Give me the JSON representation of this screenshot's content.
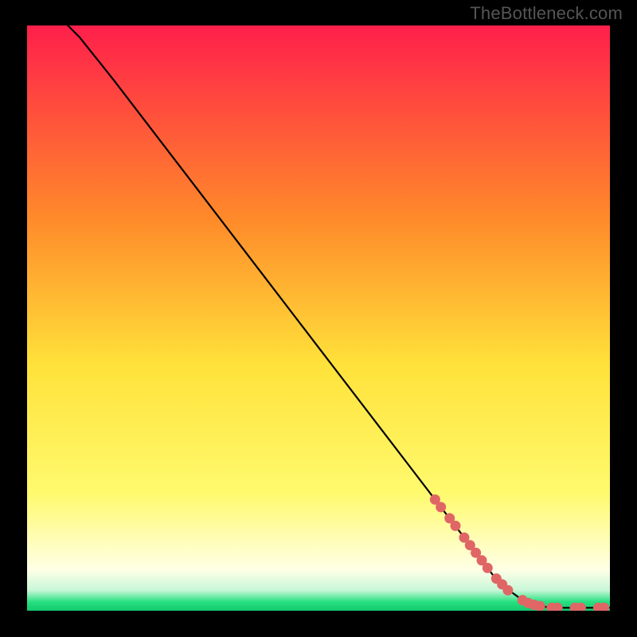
{
  "attribution": "TheBottleneck.com",
  "colors": {
    "gradient_top": "#ff1f4b",
    "gradient_mid1": "#ff8a2a",
    "gradient_mid2": "#ffe23a",
    "gradient_mid3": "#fffa6e",
    "gradient_low": "#ffffe6",
    "gradient_bottom": "#26e07f",
    "curve": "#000000",
    "marker": "#e06666",
    "frame": "#000000"
  },
  "chart_data": {
    "type": "line",
    "title": "",
    "xlabel": "",
    "ylabel": "",
    "xlim": [
      0,
      100
    ],
    "ylim": [
      0,
      100
    ],
    "grid": false,
    "legend": false,
    "series": [
      {
        "name": "curve",
        "x": [
          7,
          9,
          11,
          13,
          15,
          20,
          30,
          40,
          50,
          60,
          70,
          75,
          78,
          80,
          82,
          85,
          88,
          90,
          92,
          94,
          96,
          98,
          100
        ],
        "y": [
          100,
          98,
          95.5,
          93,
          90.5,
          84,
          71,
          58,
          45,
          32,
          19,
          12.5,
          8.6,
          6,
          4,
          1.8,
          0.8,
          0.5,
          0.5,
          0.5,
          0.5,
          0.5,
          0.5
        ]
      }
    ],
    "markers": {
      "name": "highlighted-points",
      "x": [
        70,
        71,
        72.5,
        73.5,
        75,
        76,
        77,
        78,
        79,
        80.5,
        81.5,
        82.5,
        85,
        86,
        87,
        88,
        90,
        91,
        94,
        95,
        98,
        99
      ],
      "y": [
        19,
        17.7,
        15.8,
        14.5,
        12.5,
        11.2,
        9.9,
        8.6,
        7.3,
        5.5,
        4.5,
        3.5,
        1.8,
        1.3,
        1.0,
        0.8,
        0.5,
        0.5,
        0.5,
        0.5,
        0.5,
        0.5
      ]
    }
  }
}
